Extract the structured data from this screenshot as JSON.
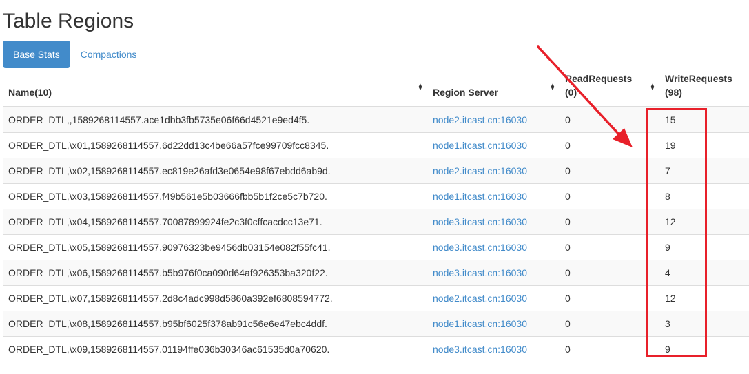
{
  "page": {
    "title": "Table Regions"
  },
  "tabs": [
    {
      "label": "Base Stats",
      "active": true
    },
    {
      "label": "Compactions",
      "active": false
    }
  ],
  "table": {
    "columns": [
      {
        "label": "Name(10)"
      },
      {
        "label": "Region Server"
      },
      {
        "label": "ReadRequests (0)"
      },
      {
        "label": "WriteRequests (98)"
      }
    ],
    "rows": [
      {
        "name": "ORDER_DTL,,1589268114557.ace1dbb3fb5735e06f66d4521e9ed4f5.",
        "server": "node2.itcast.cn:16030",
        "read": "0",
        "write": "15"
      },
      {
        "name": "ORDER_DTL,\\x01,1589268114557.6d22dd13c4be66a57fce99709fcc8345.",
        "server": "node1.itcast.cn:16030",
        "read": "0",
        "write": "19"
      },
      {
        "name": "ORDER_DTL,\\x02,1589268114557.ec819e26afd3e0654e98f67ebdd6ab9d.",
        "server": "node2.itcast.cn:16030",
        "read": "0",
        "write": "7"
      },
      {
        "name": "ORDER_DTL,\\x03,1589268114557.f49b561e5b03666fbb5b1f2ce5c7b720.",
        "server": "node1.itcast.cn:16030",
        "read": "0",
        "write": "8"
      },
      {
        "name": "ORDER_DTL,\\x04,1589268114557.70087899924fe2c3f0cffcacdcc13e71.",
        "server": "node3.itcast.cn:16030",
        "read": "0",
        "write": "12"
      },
      {
        "name": "ORDER_DTL,\\x05,1589268114557.90976323be9456db03154e082f55fc41.",
        "server": "node3.itcast.cn:16030",
        "read": "0",
        "write": "9"
      },
      {
        "name": "ORDER_DTL,\\x06,1589268114557.b5b976f0ca090d64af926353ba320f22.",
        "server": "node3.itcast.cn:16030",
        "read": "0",
        "write": "4"
      },
      {
        "name": "ORDER_DTL,\\x07,1589268114557.2d8c4adc998d5860a392ef6808594772.",
        "server": "node2.itcast.cn:16030",
        "read": "0",
        "write": "12"
      },
      {
        "name": "ORDER_DTL,\\x08,1589268114557.b95bf6025f378ab91c56e6e47ebc4ddf.",
        "server": "node1.itcast.cn:16030",
        "read": "0",
        "write": "3"
      },
      {
        "name": "ORDER_DTL,\\x09,1589268114557.01194ffe036b30346ac61535d0a70620.",
        "server": "node3.itcast.cn:16030",
        "read": "0",
        "write": "9"
      }
    ]
  },
  "colors": {
    "accent": "#428bca",
    "annotation": "#e8202a",
    "text": "#333333",
    "border": "#dddddd"
  },
  "icons": {
    "sort": "sort-both-icon"
  }
}
